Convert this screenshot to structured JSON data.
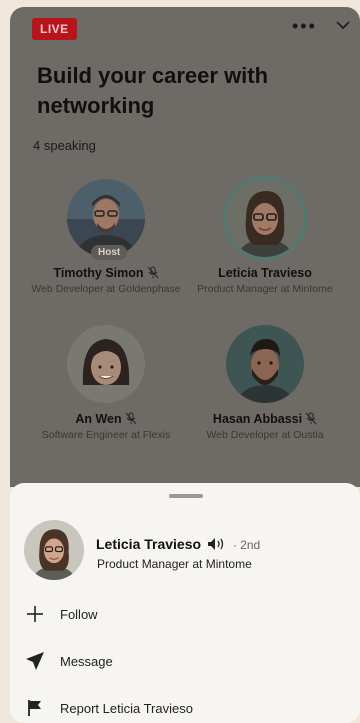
{
  "room": {
    "live_badge": "LIVE",
    "title": "Build your career with networking",
    "speaking_count": "4 speaking",
    "host_label": "Host",
    "speakers": [
      {
        "name": "Timothy Simon",
        "role": "Web Developer at Goldenphase",
        "host": true
      },
      {
        "name": "Leticia Travieso",
        "role": "Product Manager at Mintome",
        "active": true
      },
      {
        "name": "An Wen",
        "role": "Software Engineer at Flexis"
      },
      {
        "name": "Hasan Abbassi",
        "role": "Web Developer at Oustia"
      }
    ]
  },
  "icons": [
    "more-icon",
    "chevron-down-icon",
    "mic-muted-icon",
    "speaker-icon",
    "plus-icon",
    "send-icon",
    "flag-icon"
  ],
  "profile": {
    "name": "Leticia Travieso",
    "degree": "· 2nd",
    "role": "Product Manager at Mintome"
  },
  "actions": [
    {
      "label": "Follow",
      "icon": "plus-icon"
    },
    {
      "label": "Message",
      "icon": "send-icon"
    },
    {
      "label": "Report Leticia Travieso",
      "icon": "flag-icon"
    }
  ],
  "colors": {
    "live": "#b5151b",
    "active_ring": "#4f7a72",
    "sheet": "#f7f5f1"
  }
}
